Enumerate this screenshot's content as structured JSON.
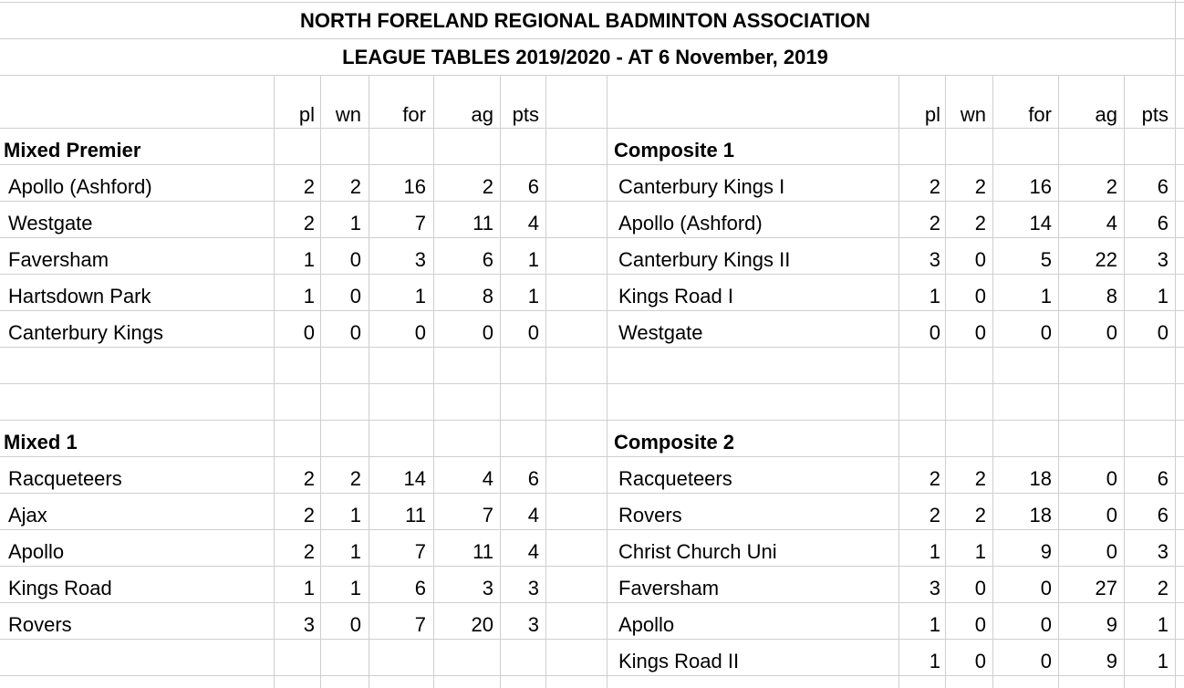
{
  "header": {
    "title": "NORTH FORELAND REGIONAL BADMINTON ASSOCIATION",
    "subtitle": "LEAGUE TABLES 2019/2020 - AT 6 November, 2019"
  },
  "columns": [
    "pl",
    "wn",
    "for",
    "ag",
    "pts"
  ],
  "divisions": {
    "mixed_premier": {
      "name": "Mixed Premier",
      "rows": [
        {
          "team": "Apollo (Ashford)",
          "pl": "2",
          "wn": "2",
          "for": "16",
          "ag": "2",
          "pts": "6"
        },
        {
          "team": "Westgate",
          "pl": "2",
          "wn": "1",
          "for": "7",
          "ag": "11",
          "pts": "4"
        },
        {
          "team": "Faversham",
          "pl": "1",
          "wn": "0",
          "for": "3",
          "ag": "6",
          "pts": "1"
        },
        {
          "team": "Hartsdown Park",
          "pl": "1",
          "wn": "0",
          "for": "1",
          "ag": "8",
          "pts": "1"
        },
        {
          "team": "Canterbury Kings",
          "pl": "0",
          "wn": "0",
          "for": "0",
          "ag": "0",
          "pts": "0"
        }
      ]
    },
    "composite_1": {
      "name": "Composite 1",
      "rows": [
        {
          "team": "Canterbury Kings I",
          "pl": "2",
          "wn": "2",
          "for": "16",
          "ag": "2",
          "pts": "6"
        },
        {
          "team": "Apollo (Ashford)",
          "pl": "2",
          "wn": "2",
          "for": "14",
          "ag": "4",
          "pts": "6"
        },
        {
          "team": "Canterbury Kings II",
          "pl": "3",
          "wn": "0",
          "for": "5",
          "ag": "22",
          "pts": "3"
        },
        {
          "team": "Kings Road I",
          "pl": "1",
          "wn": "0",
          "for": "1",
          "ag": "8",
          "pts": "1"
        },
        {
          "team": "Westgate",
          "pl": "0",
          "wn": "0",
          "for": "0",
          "ag": "0",
          "pts": "0"
        }
      ]
    },
    "mixed_1": {
      "name": "Mixed 1",
      "rows": [
        {
          "team": "Racqueteers",
          "pl": "2",
          "wn": "2",
          "for": "14",
          "ag": "4",
          "pts": "6"
        },
        {
          "team": "Ajax",
          "pl": "2",
          "wn": "1",
          "for": "11",
          "ag": "7",
          "pts": "4"
        },
        {
          "team": "Apollo",
          "pl": "2",
          "wn": "1",
          "for": "7",
          "ag": "11",
          "pts": "4"
        },
        {
          "team": "Kings Road",
          "pl": "1",
          "wn": "1",
          "for": "6",
          "ag": "3",
          "pts": "3"
        },
        {
          "team": "Rovers",
          "pl": "3",
          "wn": "0",
          "for": "7",
          "ag": "20",
          "pts": "3"
        }
      ]
    },
    "composite_2": {
      "name": "Composite 2",
      "rows": [
        {
          "team": "Racqueteers",
          "pl": "2",
          "wn": "2",
          "for": "18",
          "ag": "0",
          "pts": "6"
        },
        {
          "team": "Rovers",
          "pl": "2",
          "wn": "2",
          "for": "18",
          "ag": "0",
          "pts": "6"
        },
        {
          "team": "Christ Church Uni",
          "pl": "1",
          "wn": "1",
          "for": "9",
          "ag": "0",
          "pts": "3"
        },
        {
          "team": "Faversham",
          "pl": "3",
          "wn": "0",
          "for": "0",
          "ag": "27",
          "pts": "2"
        },
        {
          "team": "Apollo",
          "pl": "1",
          "wn": "0",
          "for": "0",
          "ag": "9",
          "pts": "1"
        },
        {
          "team": "Kings Road II",
          "pl": "1",
          "wn": "0",
          "for": "0",
          "ag": "9",
          "pts": "1"
        }
      ]
    }
  }
}
